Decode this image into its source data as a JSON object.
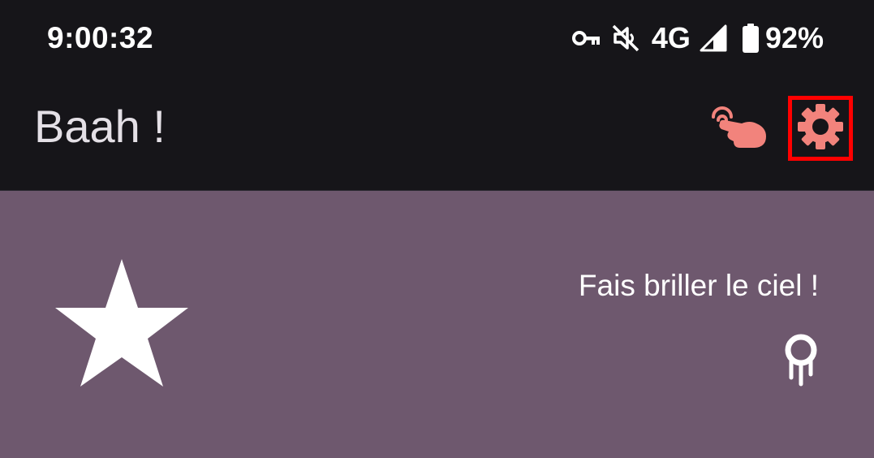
{
  "status_bar": {
    "time": "9:00:32",
    "network": "4G",
    "battery": "92%",
    "icons": [
      "vpn-key-icon",
      "mute-icon",
      "signal-icon",
      "battery-icon"
    ]
  },
  "app_bar": {
    "title": "Baah !",
    "actions": [
      {
        "name": "tap-icon",
        "color": "#f2837c"
      },
      {
        "name": "settings-icon",
        "color": "#f2837c",
        "highlighted": true
      }
    ]
  },
  "card": {
    "background": "#6e586e",
    "icon": "star-icon",
    "text": "Fais briller le ciel !",
    "secondary_icon": "meteor-icon"
  },
  "colors": {
    "accent": "#f2837c",
    "highlight_border": "#ff0000",
    "bar_background": "#161519"
  }
}
